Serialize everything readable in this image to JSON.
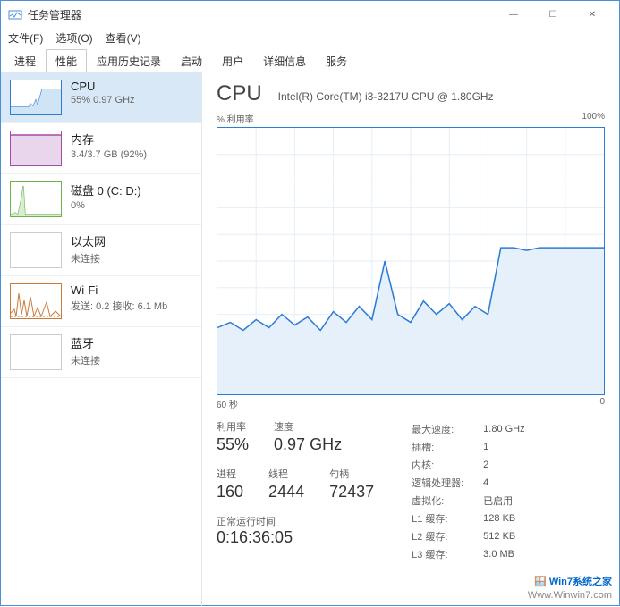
{
  "window": {
    "title": "任务管理器",
    "min": "—",
    "max": "☐",
    "close": "✕"
  },
  "menu": {
    "file": "文件(F)",
    "options": "选项(O)",
    "view": "查看(V)"
  },
  "tabs": {
    "processes": "进程",
    "performance": "性能",
    "history": "应用历史记录",
    "startup": "启动",
    "users": "用户",
    "details": "详细信息",
    "services": "服务"
  },
  "sidebar": {
    "cpu": {
      "name": "CPU",
      "stat": "55% 0.97 GHz"
    },
    "mem": {
      "name": "内存",
      "stat": "3.4/3.7 GB (92%)"
    },
    "disk": {
      "name": "磁盘 0 (C: D:)",
      "stat": "0%"
    },
    "eth": {
      "name": "以太网",
      "stat": "未连接"
    },
    "wifi": {
      "name": "Wi-Fi",
      "stat": "发送: 0.2 接收: 6.1 Mb"
    },
    "bt": {
      "name": "蓝牙",
      "stat": "未连接"
    }
  },
  "main": {
    "title": "CPU",
    "subtitle": "Intel(R) Core(TM) i3-3217U CPU @ 1.80GHz",
    "chart_top_left": "% 利用率",
    "chart_top_right": "100%",
    "chart_bot_left": "60 秒",
    "chart_bot_right": "0",
    "stats": {
      "util_lbl": "利用率",
      "util_val": "55%",
      "speed_lbl": "速度",
      "speed_val": "0.97 GHz",
      "proc_lbl": "进程",
      "proc_val": "160",
      "thread_lbl": "线程",
      "thread_val": "2444",
      "handle_lbl": "句柄",
      "handle_val": "72437"
    },
    "details": {
      "maxspeed_lbl": "最大速度:",
      "maxspeed_val": "1.80 GHz",
      "sockets_lbl": "插槽:",
      "sockets_val": "1",
      "cores_lbl": "内核:",
      "cores_val": "2",
      "logical_lbl": "逻辑处理器:",
      "logical_val": "4",
      "virt_lbl": "虚拟化:",
      "virt_val": "已启用",
      "l1_lbl": "L1 缓存:",
      "l1_val": "128 KB",
      "l2_lbl": "L2 缓存:",
      "l2_val": "512 KB",
      "l3_lbl": "L3 缓存:",
      "l3_val": "3.0 MB"
    },
    "uptime_lbl": "正常运行时间",
    "uptime_val": "0:16:36:05"
  },
  "watermark": {
    "line1": "Win7系统之家",
    "line2": "Www.Winwin7.com"
  },
  "chart_data": {
    "type": "line",
    "title": "CPU % 利用率",
    "xlabel": "秒",
    "ylabel": "% 利用率",
    "xlim": [
      60,
      0
    ],
    "ylim": [
      0,
      100
    ],
    "x": [
      60,
      58,
      56,
      54,
      52,
      50,
      48,
      46,
      44,
      42,
      40,
      38,
      36,
      34,
      32,
      30,
      28,
      26,
      24,
      22,
      20,
      18,
      16,
      14,
      12,
      10,
      8,
      6,
      4,
      2,
      0
    ],
    "values": [
      25,
      27,
      24,
      28,
      25,
      30,
      26,
      29,
      24,
      31,
      27,
      33,
      28,
      50,
      30,
      27,
      35,
      30,
      34,
      28,
      33,
      30,
      55,
      55,
      54,
      55,
      55,
      55,
      55,
      55,
      55
    ]
  }
}
